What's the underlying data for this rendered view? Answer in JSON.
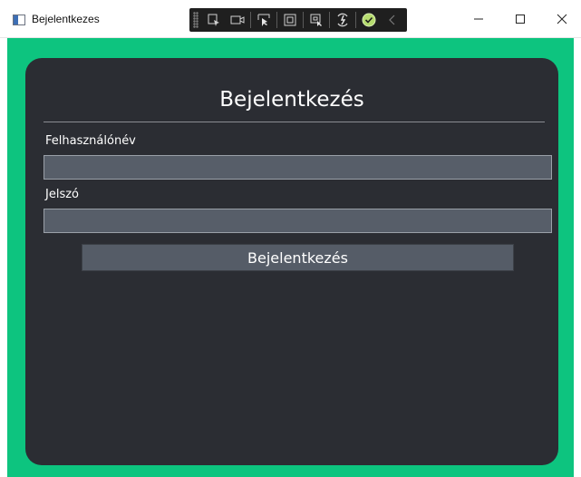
{
  "window": {
    "title": "Bejelentkezes"
  },
  "toolbar": {
    "icons": [
      "select-element-icon",
      "camera-icon",
      "pointer-icon",
      "layout-icon",
      "track-focus-icon",
      "hot-reload-icon",
      "check-icon",
      "chevron-left-icon"
    ]
  },
  "login": {
    "heading": "Bejelentkezés",
    "username_label": "Felhasználónév",
    "username_value": "",
    "password_label": "Jelszó",
    "password_value": "",
    "submit_label": "Bejelentkezés"
  },
  "colors": {
    "background_accent": "#0dc47f",
    "card": "#2b2d33",
    "input": "#575e69",
    "button": "#555c67"
  }
}
